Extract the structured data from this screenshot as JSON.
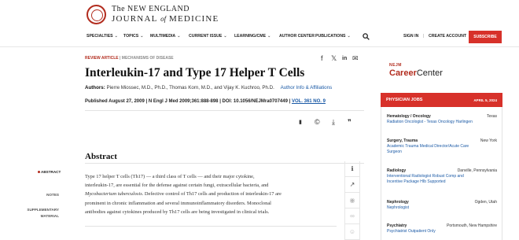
{
  "header": {
    "logo_top": "The NEW ENGLAND",
    "logo_journal": "JOURNAL",
    "logo_of": "of",
    "logo_medicine": "MEDICINE",
    "nav": [
      {
        "label": "SPECIALTIES",
        "has_menu": true
      },
      {
        "label": "TOPICS",
        "has_menu": true
      },
      {
        "label": "MULTIMEDIA",
        "has_menu": true
      },
      {
        "label": "CURRENT ISSUE",
        "has_menu": true
      },
      {
        "label": "LEARNING/CME",
        "has_menu": true
      },
      {
        "label": "AUTHOR CENTER",
        "has_menu": false
      },
      {
        "label": "PUBLICATIONS",
        "has_menu": true
      }
    ],
    "chevron": "⌄",
    "sign_in": "SIGN IN",
    "separator": "|",
    "create_account": "CREATE ACCOUNT",
    "subscribe": "SUBSCRIBE",
    "brand_color": "#d7312a"
  },
  "article": {
    "kicker_type": "REVIEW ARTICLE",
    "kicker_sep": "|",
    "kicker_section": "MECHANISMS OF DISEASE",
    "share_icons": [
      "facebook-icon",
      "x-icon",
      "linkedin-icon",
      "email-icon"
    ],
    "share_glyphs": [
      "f",
      "𝕏",
      "in",
      "✉"
    ],
    "title": "Interleukin-17 and Type 17 Helper T Cells",
    "authors_label": "Authors:",
    "authors": "Pierre Miossec, M.D., Ph.D., Thomas Korn, M.D., and Vijay K. Kuchroo, Ph.D.",
    "author_info_link": "Author Info & Affiliations",
    "published": "Published August 27, 2009 | N Engl J Med 2009;361:888-898 | DOI: 10.1056/NEJMra0707449 |",
    "volume": "VOL. 361 NO. 9",
    "tools": [
      {
        "icon": "bookmark-icon",
        "glyph": "▮"
      },
      {
        "icon": "copyright-icon",
        "glyph": "©"
      },
      {
        "icon": "download-icon",
        "glyph": "⤓"
      },
      {
        "icon": "quote-icon",
        "glyph": "❞"
      }
    ]
  },
  "sidebar_nav": {
    "abstract": "ABSTRACT",
    "notes": "NOTES",
    "supplementary_1": "SUPPLEMENTARY",
    "supplementary_2": "MATERIAL"
  },
  "abstract": {
    "heading": "Abstract",
    "line1": "Type 17 helper T cells (Th17) — a third class of T cells — and their major cytokine,",
    "line2": "interleukin-17, are essential for the defense against certain fungi, extracellular bacteria, and",
    "line3_italic": "Mycobacterium tuberculosis",
    "line3_rest": ". Defective control of Th17 cells and production of interleukin-17 are",
    "line4": "prominent in chronic inflammation and several immunoinflammatory disorders. Monoclonal",
    "line5": "antibodies against cytokines produced by Th17 cells are being investigated in clinical trials."
  },
  "side_tools": [
    {
      "icon": "info-icon",
      "glyph": "ℹ",
      "enabled": true
    },
    {
      "icon": "trending-icon",
      "glyph": "↗",
      "enabled": true
    },
    {
      "icon": "eye-icon",
      "glyph": "◉",
      "enabled": false
    },
    {
      "icon": "link-icon",
      "glyph": "∞",
      "enabled": false
    },
    {
      "icon": "person-icon",
      "glyph": "☺",
      "enabled": false
    }
  ],
  "career_center": {
    "nejm": "NEJM",
    "name_part1": "Career",
    "name_part2": "Center",
    "bar_title": "PHYSICIAN JOBS",
    "bar_date": "APRIL 5, 2024",
    "jobs": [
      {
        "category": "Hematology / Oncology",
        "location": "Texas",
        "lines": [
          "Radiation Oncologist - Texas Oncology Harlingen"
        ]
      },
      {
        "category": "Surgery, Trauma",
        "location": "New York",
        "lines": [
          "Academic Trauma Medical Director/Acute Care",
          "Surgeon"
        ]
      },
      {
        "category": "Radiology",
        "location": "Danville, Pennsylvania",
        "lines": [
          "Interventional Radiologist Robust Comp and",
          "Incentive Package HIb Supported"
        ]
      },
      {
        "category": "Nephrology",
        "location": "Ogden, Utah",
        "lines": [
          "Nephrologist"
        ]
      },
      {
        "category": "Psychiatry",
        "location": "Portsmouth, New Hampshire",
        "lines": [
          "Psychiatrist Outpatient Only"
        ]
      }
    ]
  }
}
